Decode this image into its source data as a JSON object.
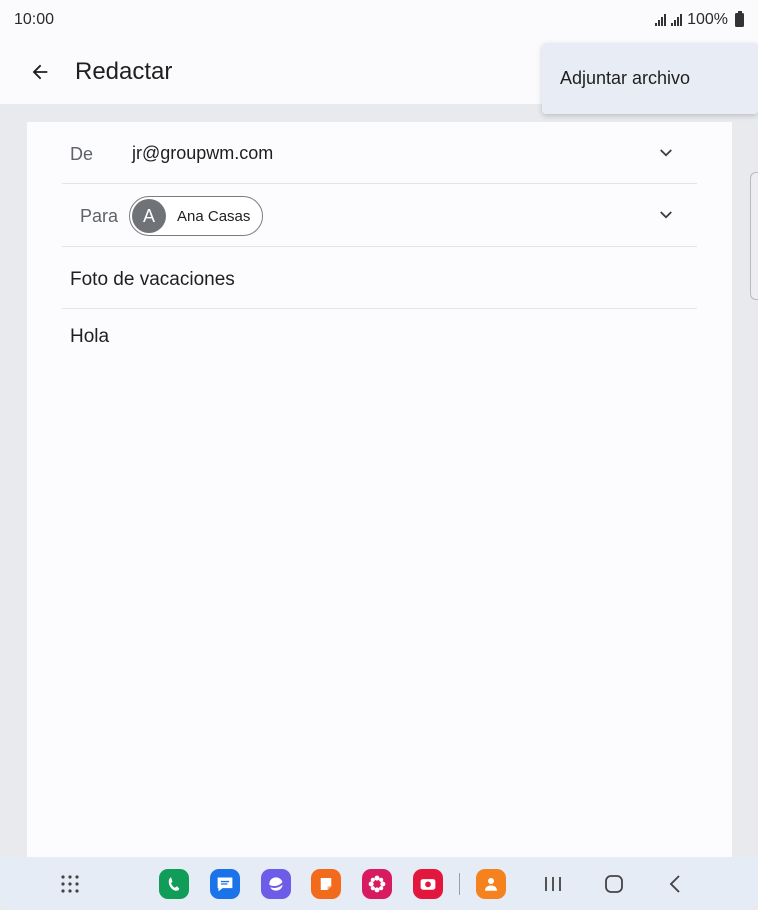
{
  "status_bar": {
    "time": "10:00",
    "battery": "100%"
  },
  "app_bar": {
    "title": "Redactar"
  },
  "compose": {
    "from_label": "De",
    "from_value": "jr@groupwm.com",
    "to_label": "Para",
    "recipient_initial": "A",
    "recipient_name": "Ana Casas",
    "subject": "Foto de vacaciones",
    "body": "Hola"
  },
  "overflow_menu": {
    "items": [
      {
        "label": "Adjuntar archivo"
      }
    ]
  },
  "dock": {
    "apps": [
      {
        "name": "phone",
        "color": "#0f9d58"
      },
      {
        "name": "messages",
        "color": "#1a73e8"
      },
      {
        "name": "internet",
        "color": "#6c5ce7"
      },
      {
        "name": "notes",
        "color": "#f26b1d"
      },
      {
        "name": "gallery",
        "color": "#d81b60"
      },
      {
        "name": "camera",
        "color": "#e3173e"
      },
      {
        "name": "contacts",
        "color": "#f5821f"
      }
    ]
  }
}
